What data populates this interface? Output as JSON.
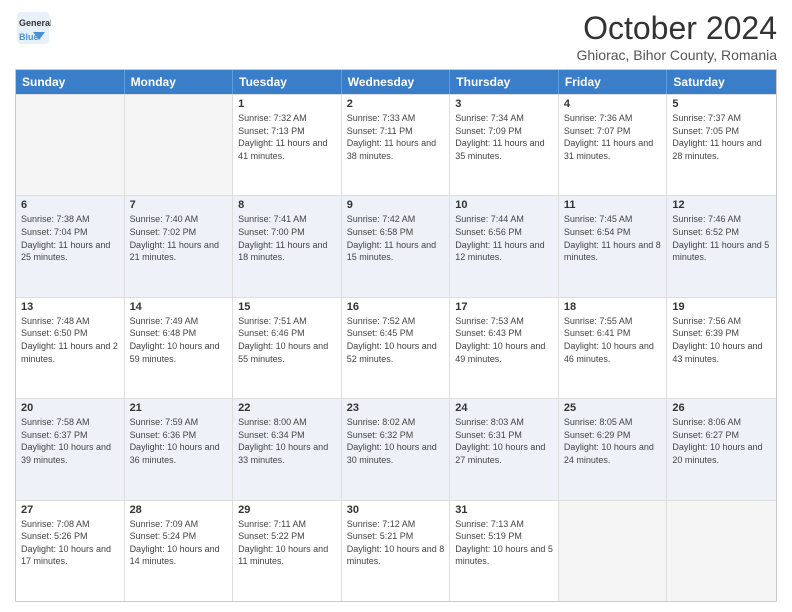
{
  "header": {
    "logo_general": "General",
    "logo_blue": "Blue",
    "title": "October 2024",
    "subtitle": "Ghiorac, Bihor County, Romania"
  },
  "days_of_week": [
    "Sunday",
    "Monday",
    "Tuesday",
    "Wednesday",
    "Thursday",
    "Friday",
    "Saturday"
  ],
  "weeks": [
    [
      {
        "day": "",
        "sunrise": "",
        "sunset": "",
        "daylight": "",
        "empty": true
      },
      {
        "day": "",
        "sunrise": "",
        "sunset": "",
        "daylight": "",
        "empty": true
      },
      {
        "day": "1",
        "sunrise": "Sunrise: 7:32 AM",
        "sunset": "Sunset: 7:13 PM",
        "daylight": "Daylight: 11 hours and 41 minutes.",
        "empty": false
      },
      {
        "day": "2",
        "sunrise": "Sunrise: 7:33 AM",
        "sunset": "Sunset: 7:11 PM",
        "daylight": "Daylight: 11 hours and 38 minutes.",
        "empty": false
      },
      {
        "day": "3",
        "sunrise": "Sunrise: 7:34 AM",
        "sunset": "Sunset: 7:09 PM",
        "daylight": "Daylight: 11 hours and 35 minutes.",
        "empty": false
      },
      {
        "day": "4",
        "sunrise": "Sunrise: 7:36 AM",
        "sunset": "Sunset: 7:07 PM",
        "daylight": "Daylight: 11 hours and 31 minutes.",
        "empty": false
      },
      {
        "day": "5",
        "sunrise": "Sunrise: 7:37 AM",
        "sunset": "Sunset: 7:05 PM",
        "daylight": "Daylight: 11 hours and 28 minutes.",
        "empty": false
      }
    ],
    [
      {
        "day": "6",
        "sunrise": "Sunrise: 7:38 AM",
        "sunset": "Sunset: 7:04 PM",
        "daylight": "Daylight: 11 hours and 25 minutes.",
        "empty": false
      },
      {
        "day": "7",
        "sunrise": "Sunrise: 7:40 AM",
        "sunset": "Sunset: 7:02 PM",
        "daylight": "Daylight: 11 hours and 21 minutes.",
        "empty": false
      },
      {
        "day": "8",
        "sunrise": "Sunrise: 7:41 AM",
        "sunset": "Sunset: 7:00 PM",
        "daylight": "Daylight: 11 hours and 18 minutes.",
        "empty": false
      },
      {
        "day": "9",
        "sunrise": "Sunrise: 7:42 AM",
        "sunset": "Sunset: 6:58 PM",
        "daylight": "Daylight: 11 hours and 15 minutes.",
        "empty": false
      },
      {
        "day": "10",
        "sunrise": "Sunrise: 7:44 AM",
        "sunset": "Sunset: 6:56 PM",
        "daylight": "Daylight: 11 hours and 12 minutes.",
        "empty": false
      },
      {
        "day": "11",
        "sunrise": "Sunrise: 7:45 AM",
        "sunset": "Sunset: 6:54 PM",
        "daylight": "Daylight: 11 hours and 8 minutes.",
        "empty": false
      },
      {
        "day": "12",
        "sunrise": "Sunrise: 7:46 AM",
        "sunset": "Sunset: 6:52 PM",
        "daylight": "Daylight: 11 hours and 5 minutes.",
        "empty": false
      }
    ],
    [
      {
        "day": "13",
        "sunrise": "Sunrise: 7:48 AM",
        "sunset": "Sunset: 6:50 PM",
        "daylight": "Daylight: 11 hours and 2 minutes.",
        "empty": false
      },
      {
        "day": "14",
        "sunrise": "Sunrise: 7:49 AM",
        "sunset": "Sunset: 6:48 PM",
        "daylight": "Daylight: 10 hours and 59 minutes.",
        "empty": false
      },
      {
        "day": "15",
        "sunrise": "Sunrise: 7:51 AM",
        "sunset": "Sunset: 6:46 PM",
        "daylight": "Daylight: 10 hours and 55 minutes.",
        "empty": false
      },
      {
        "day": "16",
        "sunrise": "Sunrise: 7:52 AM",
        "sunset": "Sunset: 6:45 PM",
        "daylight": "Daylight: 10 hours and 52 minutes.",
        "empty": false
      },
      {
        "day": "17",
        "sunrise": "Sunrise: 7:53 AM",
        "sunset": "Sunset: 6:43 PM",
        "daylight": "Daylight: 10 hours and 49 minutes.",
        "empty": false
      },
      {
        "day": "18",
        "sunrise": "Sunrise: 7:55 AM",
        "sunset": "Sunset: 6:41 PM",
        "daylight": "Daylight: 10 hours and 46 minutes.",
        "empty": false
      },
      {
        "day": "19",
        "sunrise": "Sunrise: 7:56 AM",
        "sunset": "Sunset: 6:39 PM",
        "daylight": "Daylight: 10 hours and 43 minutes.",
        "empty": false
      }
    ],
    [
      {
        "day": "20",
        "sunrise": "Sunrise: 7:58 AM",
        "sunset": "Sunset: 6:37 PM",
        "daylight": "Daylight: 10 hours and 39 minutes.",
        "empty": false
      },
      {
        "day": "21",
        "sunrise": "Sunrise: 7:59 AM",
        "sunset": "Sunset: 6:36 PM",
        "daylight": "Daylight: 10 hours and 36 minutes.",
        "empty": false
      },
      {
        "day": "22",
        "sunrise": "Sunrise: 8:00 AM",
        "sunset": "Sunset: 6:34 PM",
        "daylight": "Daylight: 10 hours and 33 minutes.",
        "empty": false
      },
      {
        "day": "23",
        "sunrise": "Sunrise: 8:02 AM",
        "sunset": "Sunset: 6:32 PM",
        "daylight": "Daylight: 10 hours and 30 minutes.",
        "empty": false
      },
      {
        "day": "24",
        "sunrise": "Sunrise: 8:03 AM",
        "sunset": "Sunset: 6:31 PM",
        "daylight": "Daylight: 10 hours and 27 minutes.",
        "empty": false
      },
      {
        "day": "25",
        "sunrise": "Sunrise: 8:05 AM",
        "sunset": "Sunset: 6:29 PM",
        "daylight": "Daylight: 10 hours and 24 minutes.",
        "empty": false
      },
      {
        "day": "26",
        "sunrise": "Sunrise: 8:06 AM",
        "sunset": "Sunset: 6:27 PM",
        "daylight": "Daylight: 10 hours and 20 minutes.",
        "empty": false
      }
    ],
    [
      {
        "day": "27",
        "sunrise": "Sunrise: 7:08 AM",
        "sunset": "Sunset: 5:26 PM",
        "daylight": "Daylight: 10 hours and 17 minutes.",
        "empty": false
      },
      {
        "day": "28",
        "sunrise": "Sunrise: 7:09 AM",
        "sunset": "Sunset: 5:24 PM",
        "daylight": "Daylight: 10 hours and 14 minutes.",
        "empty": false
      },
      {
        "day": "29",
        "sunrise": "Sunrise: 7:11 AM",
        "sunset": "Sunset: 5:22 PM",
        "daylight": "Daylight: 10 hours and 11 minutes.",
        "empty": false
      },
      {
        "day": "30",
        "sunrise": "Sunrise: 7:12 AM",
        "sunset": "Sunset: 5:21 PM",
        "daylight": "Daylight: 10 hours and 8 minutes.",
        "empty": false
      },
      {
        "day": "31",
        "sunrise": "Sunrise: 7:13 AM",
        "sunset": "Sunset: 5:19 PM",
        "daylight": "Daylight: 10 hours and 5 minutes.",
        "empty": false
      },
      {
        "day": "",
        "sunrise": "",
        "sunset": "",
        "daylight": "",
        "empty": true
      },
      {
        "day": "",
        "sunrise": "",
        "sunset": "",
        "daylight": "",
        "empty": true
      }
    ]
  ]
}
